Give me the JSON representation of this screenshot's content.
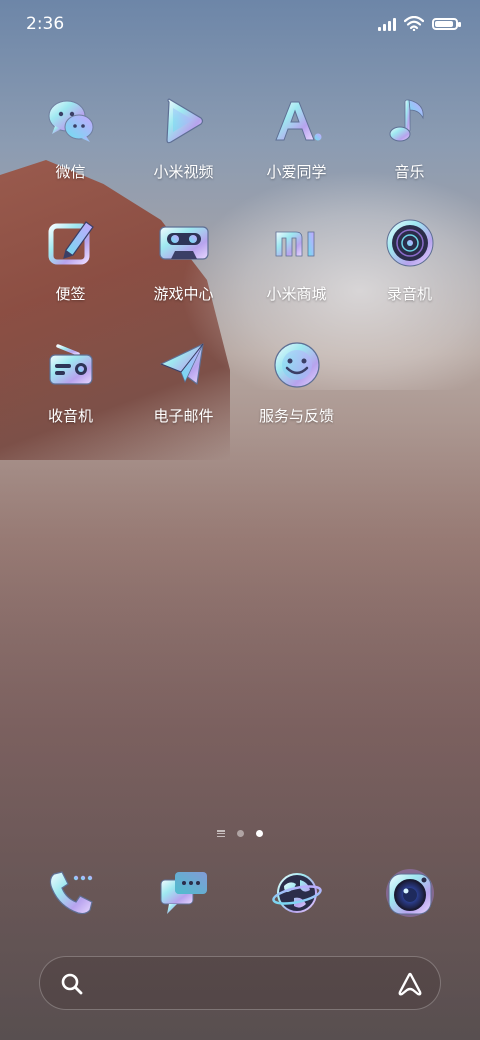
{
  "status_bar": {
    "time": "2:36"
  },
  "apps": [
    {
      "label": "微信",
      "icon": "chat-bubbles-icon"
    },
    {
      "label": "小米视频",
      "icon": "play-icon"
    },
    {
      "label": "小爱同学",
      "icon": "letter-a-icon"
    },
    {
      "label": "音乐",
      "icon": "music-note-icon"
    },
    {
      "label": "便签",
      "icon": "notepad-pen-icon"
    },
    {
      "label": "游戏中心",
      "icon": "cassette-icon"
    },
    {
      "label": "小米商城",
      "icon": "mi-logo-icon"
    },
    {
      "label": "录音机",
      "icon": "recorder-disc-icon"
    },
    {
      "label": "收音机",
      "icon": "radio-icon"
    },
    {
      "label": "电子邮件",
      "icon": "paper-plane-icon"
    },
    {
      "label": "服务与反馈",
      "icon": "smiley-icon"
    }
  ],
  "page_indicator": {
    "pages": 2,
    "active_page": 2
  },
  "dock": [
    {
      "app": "phone",
      "icon": "phone-icon"
    },
    {
      "app": "messages",
      "icon": "message-icon"
    },
    {
      "app": "browser",
      "icon": "globe-icon"
    },
    {
      "app": "camera",
      "icon": "camera-icon"
    }
  ],
  "colors": {
    "icon_gradient_start": "#b8f2ff",
    "icon_gradient_end": "#c9a9ff",
    "icon_dark": "#2b2d4a"
  }
}
